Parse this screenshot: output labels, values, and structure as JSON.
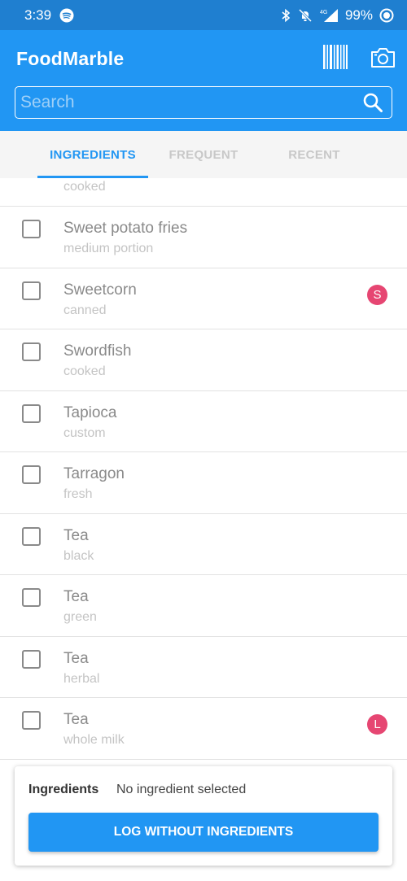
{
  "status_bar": {
    "time": "3:39",
    "battery": "99%",
    "network": "4G",
    "icons": [
      "spotify-icon",
      "bluetooth-icon",
      "mute-icon",
      "signal-icon",
      "battery-icon"
    ]
  },
  "app": {
    "title": "FoodMarble",
    "accent_color": "#2196f3"
  },
  "search": {
    "placeholder": "Search",
    "value": ""
  },
  "tabs": [
    {
      "label": "INGREDIENTS",
      "active": true
    },
    {
      "label": "FREQUENT",
      "active": false
    },
    {
      "label": "RECENT",
      "active": false
    }
  ],
  "list": {
    "partial_top_subtitle": "cooked",
    "items": [
      {
        "name": "Sweet potato fries",
        "subtitle": "medium portion",
        "badge": "",
        "checked": false
      },
      {
        "name": "Sweetcorn",
        "subtitle": "canned",
        "badge": "S",
        "checked": false
      },
      {
        "name": "Swordfish",
        "subtitle": "cooked",
        "badge": "",
        "checked": false
      },
      {
        "name": "Tapioca",
        "subtitle": "custom",
        "badge": "",
        "checked": false
      },
      {
        "name": "Tarragon",
        "subtitle": "fresh",
        "badge": "",
        "checked": false
      },
      {
        "name": "Tea",
        "subtitle": "black",
        "badge": "",
        "checked": false
      },
      {
        "name": "Tea",
        "subtitle": "green",
        "badge": "",
        "checked": false
      },
      {
        "name": "Tea",
        "subtitle": "herbal",
        "badge": "",
        "checked": false
      },
      {
        "name": "Tea",
        "subtitle": "whole milk",
        "badge": "L",
        "checked": false
      }
    ],
    "badge_color": "#e64672"
  },
  "bottom_card": {
    "label": "Ingredients",
    "value": "No ingredient selected",
    "button_label": "LOG WITHOUT INGREDIENTS"
  }
}
